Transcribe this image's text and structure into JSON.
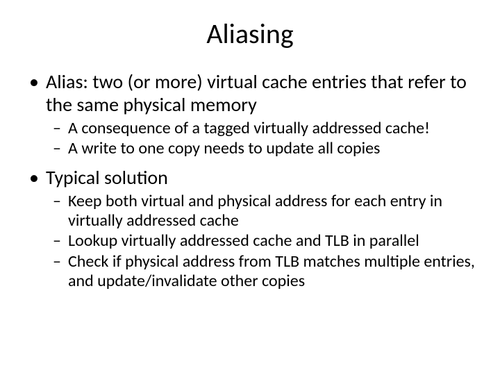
{
  "title": "Aliasing",
  "bullets": [
    {
      "text": "Alias: two (or more) virtual cache entries that refer to the same physical memory",
      "subs": [
        "A consequence of a tagged virtually addressed cache!",
        "A write to one copy needs to update all copies"
      ]
    },
    {
      "text": "Typical solution",
      "subs": [
        "Keep both virtual and physical address for each entry in virtually addressed cache",
        "Lookup virtually addressed cache and TLB in parallel",
        "Check if physical address from TLB matches multiple entries, and update/invalidate other copies"
      ]
    }
  ]
}
